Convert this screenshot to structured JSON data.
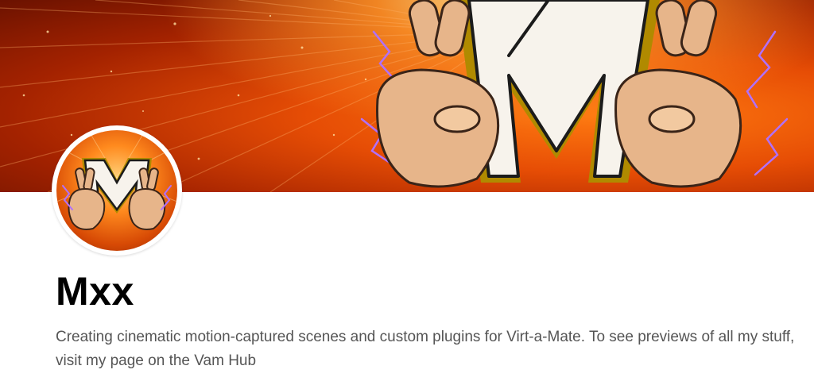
{
  "profile": {
    "name": "Mxx",
    "bio": "Creating cinematic motion-captured scenes and custom plugins for Virt-a-Mate. To see previews of all my stuff, visit my page on the Vam Hub"
  },
  "images": {
    "banner_icon": "m-logo-crossed-fingers-banner",
    "avatar_icon": "m-logo-crossed-fingers-avatar"
  },
  "colors": {
    "banner_orange": "#e64d05",
    "banner_glow": "#ffd27a",
    "lightning_purple": "#b070ff",
    "text_primary": "#000000",
    "text_secondary": "#555555"
  }
}
